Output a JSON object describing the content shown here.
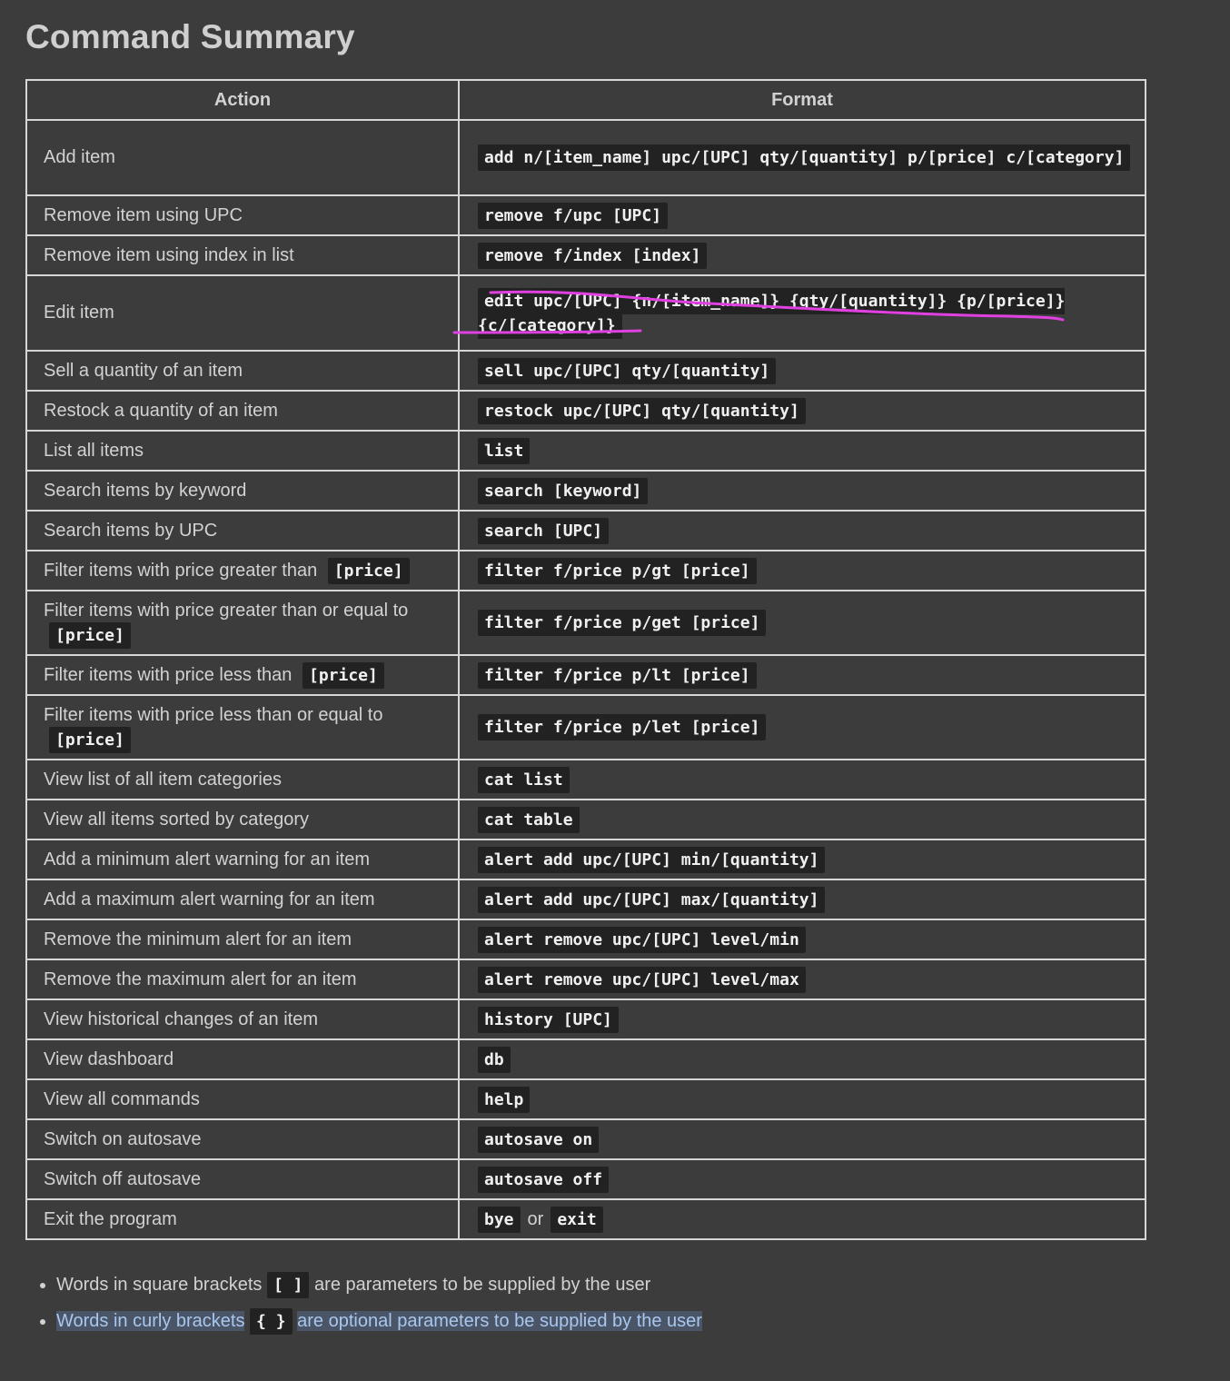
{
  "title": "Command Summary",
  "table": {
    "headers": [
      "Action",
      "Format"
    ],
    "rows": [
      {
        "action": "Add item",
        "format": "add n/[item_name] upc/[UPC] qty/[quantity] p/[price] c/[category]"
      },
      {
        "action": "Remove item using UPC",
        "format": "remove f/upc [UPC]"
      },
      {
        "action": "Remove item using index in list",
        "format": "remove f/index [index]"
      },
      {
        "action": "Edit item",
        "format": "edit upc/[UPC] {n/[item_name]} {qty/[quantity]} {p/[price]} {c/[category]}"
      },
      {
        "action": "Sell a quantity of an item",
        "format": "sell upc/[UPC] qty/[quantity]"
      },
      {
        "action": "Restock a quantity of an item",
        "format": "restock upc/[UPC] qty/[quantity]"
      },
      {
        "action": "List all items",
        "format": "list"
      },
      {
        "action": "Search items by keyword",
        "format": "search [keyword]"
      },
      {
        "action": "Search items by UPC",
        "format": "search [UPC]"
      },
      {
        "action": "Filter items with price greater than",
        "action_code": "[price]",
        "format": "filter f/price p/gt [price]"
      },
      {
        "action": "Filter items with price greater than or equal to",
        "action_code": "[price]",
        "format": "filter f/price p/get [price]"
      },
      {
        "action": "Filter items with price less than",
        "action_code": "[price]",
        "format": "filter f/price p/lt [price]"
      },
      {
        "action": "Filter items with price less than or equal to",
        "action_code": "[price]",
        "format": "filter f/price p/let [price]"
      },
      {
        "action": "View list of all item categories",
        "format": "cat list"
      },
      {
        "action": "View all items sorted by category",
        "format": "cat table"
      },
      {
        "action": "Add a minimum alert warning for an item",
        "format": "alert add upc/[UPC] min/[quantity]"
      },
      {
        "action": "Add a maximum alert warning for an item",
        "format": "alert add upc/[UPC] max/[quantity]"
      },
      {
        "action": "Remove the minimum alert for an item",
        "format": "alert remove upc/[UPC] level/min"
      },
      {
        "action": "Remove the maximum alert for an item",
        "format": "alert remove upc/[UPC] level/max"
      },
      {
        "action": "View historical changes of an item",
        "format": "history [UPC]"
      },
      {
        "action": "View dashboard",
        "format": "db"
      },
      {
        "action": "View all commands",
        "format": "help"
      },
      {
        "action": "Switch on autosave",
        "format": "autosave on"
      },
      {
        "action": "Switch off autosave",
        "format": "autosave off"
      },
      {
        "action": "Exit the program",
        "format": "bye",
        "format_or": "or",
        "format_alt": "exit"
      }
    ]
  },
  "notes": [
    {
      "before": "Words in square brackets",
      "code": "[ ]",
      "after": "are parameters to be supplied by the user",
      "highlighted": false
    },
    {
      "before": "Words in curly brackets",
      "code": "{ }",
      "after": "are optional parameters to be supplied by the user",
      "highlighted": true
    }
  ],
  "colors": {
    "background": "#3c3c3c",
    "code_background": "#222222",
    "annotation_stroke": "#e040e0",
    "highlight_text": "#a9c7ee"
  }
}
